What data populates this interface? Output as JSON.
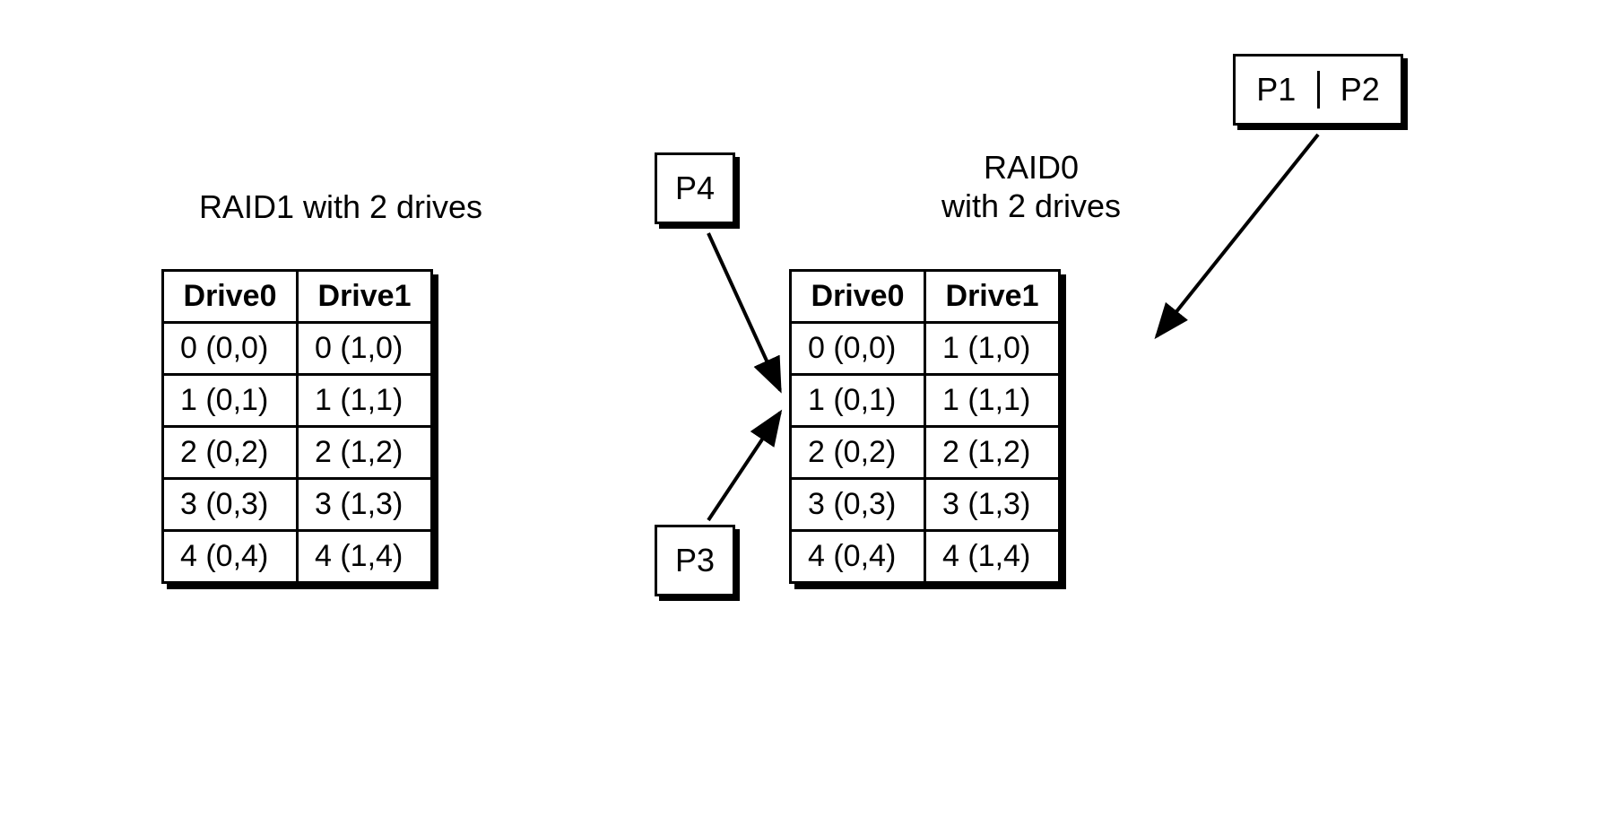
{
  "raid1": {
    "title": "RAID1 with 2 drives",
    "headers": [
      "Drive0",
      "Drive1"
    ],
    "rows": [
      [
        "0 (0,0)",
        "0 (1,0)"
      ],
      [
        "1 (0,1)",
        "1 (1,1)"
      ],
      [
        "2 (0,2)",
        "2 (1,2)"
      ],
      [
        "3 (0,3)",
        "3 (1,3)"
      ],
      [
        "4 (0,4)",
        "4 (1,4)"
      ]
    ]
  },
  "raid0": {
    "title": "RAID0\nwith 2 drives",
    "title_line1": "RAID0",
    "title_line2": "with 2 drives",
    "headers": [
      "Drive0",
      "Drive1"
    ],
    "rows": [
      [
        "0 (0,0)",
        "1 (1,0)"
      ],
      [
        "1 (0,1)",
        "1 (1,1)"
      ],
      [
        "2 (0,2)",
        "2 (1,2)"
      ],
      [
        "3 (0,3)",
        "3 (1,3)"
      ],
      [
        "4 (0,4)",
        "4 (1,4)"
      ]
    ]
  },
  "processes": {
    "p1": "P1",
    "p2": "P2",
    "p3": "P3",
    "p4": "P4"
  }
}
